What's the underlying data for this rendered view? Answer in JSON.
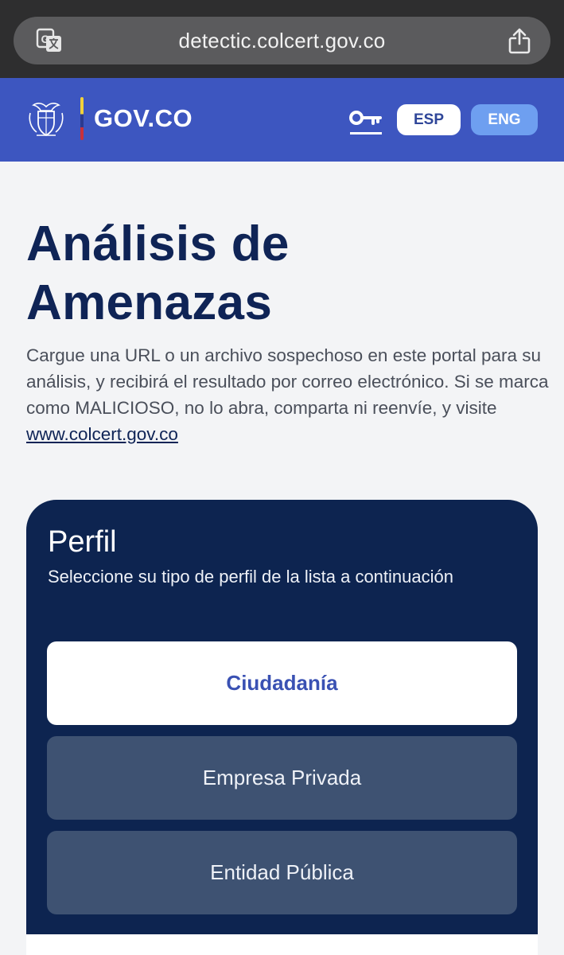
{
  "browser": {
    "url": "detectic.colcert.gov.co",
    "left_icon": "translate-icon",
    "right_icon": "share-icon"
  },
  "header": {
    "logo_text": "GOV.CO",
    "coat_icon": "coat-of-arms-icon",
    "key_icon": "key-icon",
    "lang_esp": "ESP",
    "lang_eng": "ENG",
    "selected_lang": "ESP"
  },
  "main": {
    "title_line1": "Análisis de",
    "title_line2": "Amenazas",
    "description": "Cargue una URL o un archivo sospechoso en este portal para su análisis, y recibirá el resultado por correo electrónico. Si se marca como MALICIOSO, no lo abra, comparta ni reenvíe, y visite ",
    "link_text": "www.colcert.gov.co"
  },
  "profile": {
    "title": "Perfil",
    "subtitle": "Seleccione su tipo de perfil de la lista a continuación",
    "options": [
      {
        "label": "Ciudadanía",
        "selected": true
      },
      {
        "label": "Empresa Privada",
        "selected": false
      },
      {
        "label": "Entidad Pública",
        "selected": false
      }
    ]
  },
  "colors": {
    "header_blue": "#3d56c0",
    "navy": "#0d2450",
    "accent_blue": "#3a51b3",
    "eng_button": "#6e9ff0"
  }
}
